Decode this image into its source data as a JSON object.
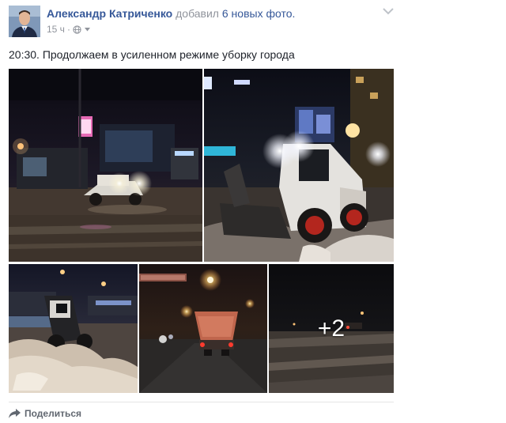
{
  "post": {
    "author": {
      "name": "Александр Катриченко",
      "action": "добавил",
      "photos_link": "6 новых фото."
    },
    "meta": {
      "time": "15 ч",
      "separator": "·",
      "audience_icon": "globe-icon"
    },
    "text": "20:30. Продолжаем в усиленном режиме уборку города",
    "photos": {
      "count_shown": 5,
      "more_label": "+2",
      "items": [
        {
          "description_icon": "snow-loader-street-night"
        },
        {
          "description_icon": "snow-loader-closeup"
        },
        {
          "description_icon": "snow-loader-pile"
        },
        {
          "description_icon": "salt-spreader-truck"
        },
        {
          "description_icon": "dark-street-snow"
        }
      ]
    },
    "actions": {
      "share_label": "Поделиться",
      "share_icon": "share-arrow-icon"
    },
    "menu_icon": "chevron-down-icon"
  },
  "colors": {
    "link": "#365899",
    "secondary_text": "#90949c",
    "body_text": "#1d2129",
    "action_text": "#616770"
  }
}
